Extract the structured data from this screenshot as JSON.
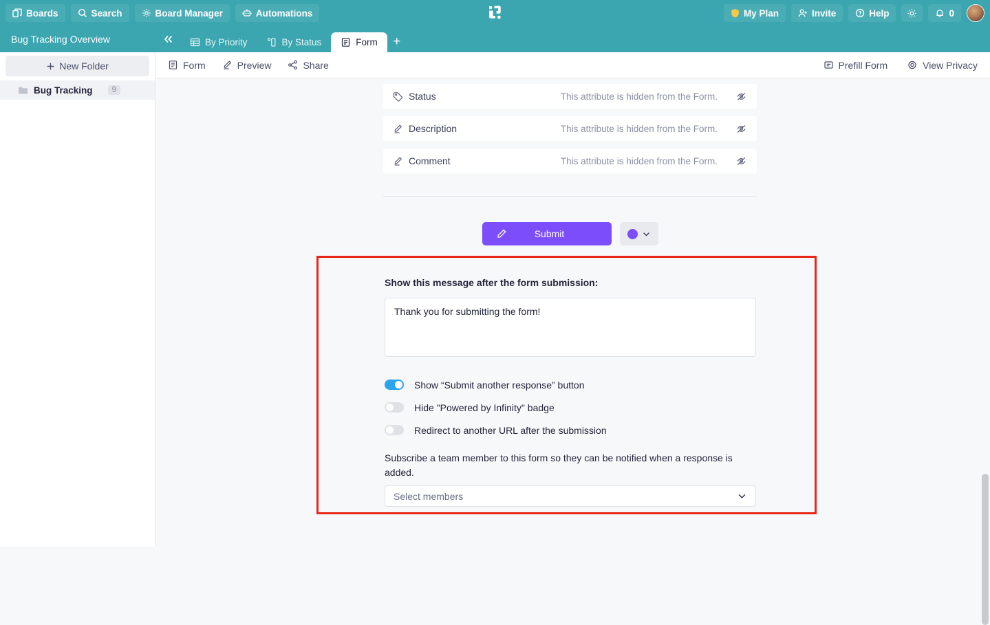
{
  "topbar": {
    "left_buttons": [
      {
        "label": "Boards",
        "icon": "boards-icon"
      },
      {
        "label": "Search",
        "icon": "search-icon"
      },
      {
        "label": "Board Manager",
        "icon": "gear-icon"
      },
      {
        "label": "Automations",
        "icon": "robot-icon"
      }
    ],
    "logo": "infinity-logo",
    "right_buttons": [
      {
        "label": "My Plan",
        "icon": "shield-icon"
      },
      {
        "label": "Invite",
        "icon": "user-add-icon"
      },
      {
        "label": "Help",
        "icon": "question-circle-icon"
      }
    ],
    "theme_toggle_icon": "sun-icon",
    "notifications": {
      "icon": "bell-icon",
      "count": "0"
    },
    "avatar": "user-avatar"
  },
  "tabstrip": {
    "board_title": "Bug Tracking Overview",
    "collapse_icon": "chevrons-left-icon",
    "tabs": [
      {
        "label": "By Priority",
        "icon": "table-icon",
        "active": false
      },
      {
        "label": "By Status",
        "icon": "columns-icon",
        "active": false
      },
      {
        "label": "Form",
        "icon": "form-icon",
        "active": true
      }
    ],
    "add_tab_label": "+"
  },
  "sidebar": {
    "new_folder_label": "New Folder",
    "new_folder_icon": "plus-icon",
    "folders": [
      {
        "name": "Bug Tracking",
        "count": "9",
        "icon": "folder-icon"
      }
    ]
  },
  "subtoolbar": {
    "left_items": [
      {
        "label": "Form",
        "icon": "form-icon"
      },
      {
        "label": "Preview",
        "icon": "pencil-icon"
      },
      {
        "label": "Share",
        "icon": "share-icon"
      }
    ],
    "right_items": [
      {
        "label": "Prefill Form",
        "icon": "prefill-icon"
      },
      {
        "label": "View Privacy",
        "icon": "eye-icon"
      }
    ]
  },
  "form": {
    "attributes": [
      {
        "name": "Status",
        "icon": "tag-icon",
        "status": "This attribute is hidden from the Form.",
        "toggle_icon": "eye-off-icon"
      },
      {
        "name": "Description",
        "icon": "pencil-icon",
        "status": "This attribute is hidden from the Form.",
        "toggle_icon": "eye-off-icon"
      },
      {
        "name": "Comment",
        "icon": "pencil-icon",
        "status": "This attribute is hidden from the Form.",
        "toggle_icon": "eye-off-icon"
      }
    ],
    "submit_button": {
      "label": "Submit",
      "icon": "pencil-icon",
      "color": "#7c4dfb"
    },
    "color_picker": {
      "swatch_color": "#7c4dfb",
      "chevron_icon": "chevron-down-icon"
    }
  },
  "highlight": {
    "border_color": "#e8261a",
    "message_label": "Show this message after the form submission:",
    "message_value": "Thank you for submitting the form!",
    "message_placeholder": "Thank you for submitting the form!",
    "toggles": [
      {
        "label": "Show “Submit another response” button",
        "on": true
      },
      {
        "label": "Hide \"Powered by Infinity\" badge",
        "on": false
      },
      {
        "label": "Redirect to another URL after the submission",
        "on": false
      }
    ],
    "subscribe_description": "Subscribe a team member to this form so they can be notified when a response is added.",
    "select_placeholder": "Select members",
    "select_chevron_icon": "chevron-down-icon"
  }
}
